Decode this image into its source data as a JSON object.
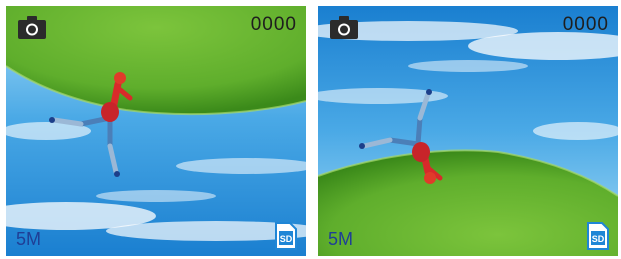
{
  "screens": [
    {
      "id": "upside-down-preview",
      "counter": "0000",
      "resolution": "5M",
      "icons": {
        "mode": "camera-icon",
        "storage": "sd-card-icon",
        "storage_label": "SD"
      }
    },
    {
      "id": "upright-preview",
      "counter": "0000",
      "resolution": "5M",
      "icons": {
        "mode": "camera-icon",
        "storage": "sd-card-icon",
        "storage_label": "SD"
      }
    }
  ],
  "colors": {
    "sky_top": "#1a7fd0",
    "sky_bottom": "#8fd0f4",
    "grass": "#5fae2c",
    "grass_dark": "#3b8a1a",
    "resolution_text": "#1f3f96",
    "counter_text": "#1e1e1e",
    "sd_blue": "#1f86d6"
  }
}
